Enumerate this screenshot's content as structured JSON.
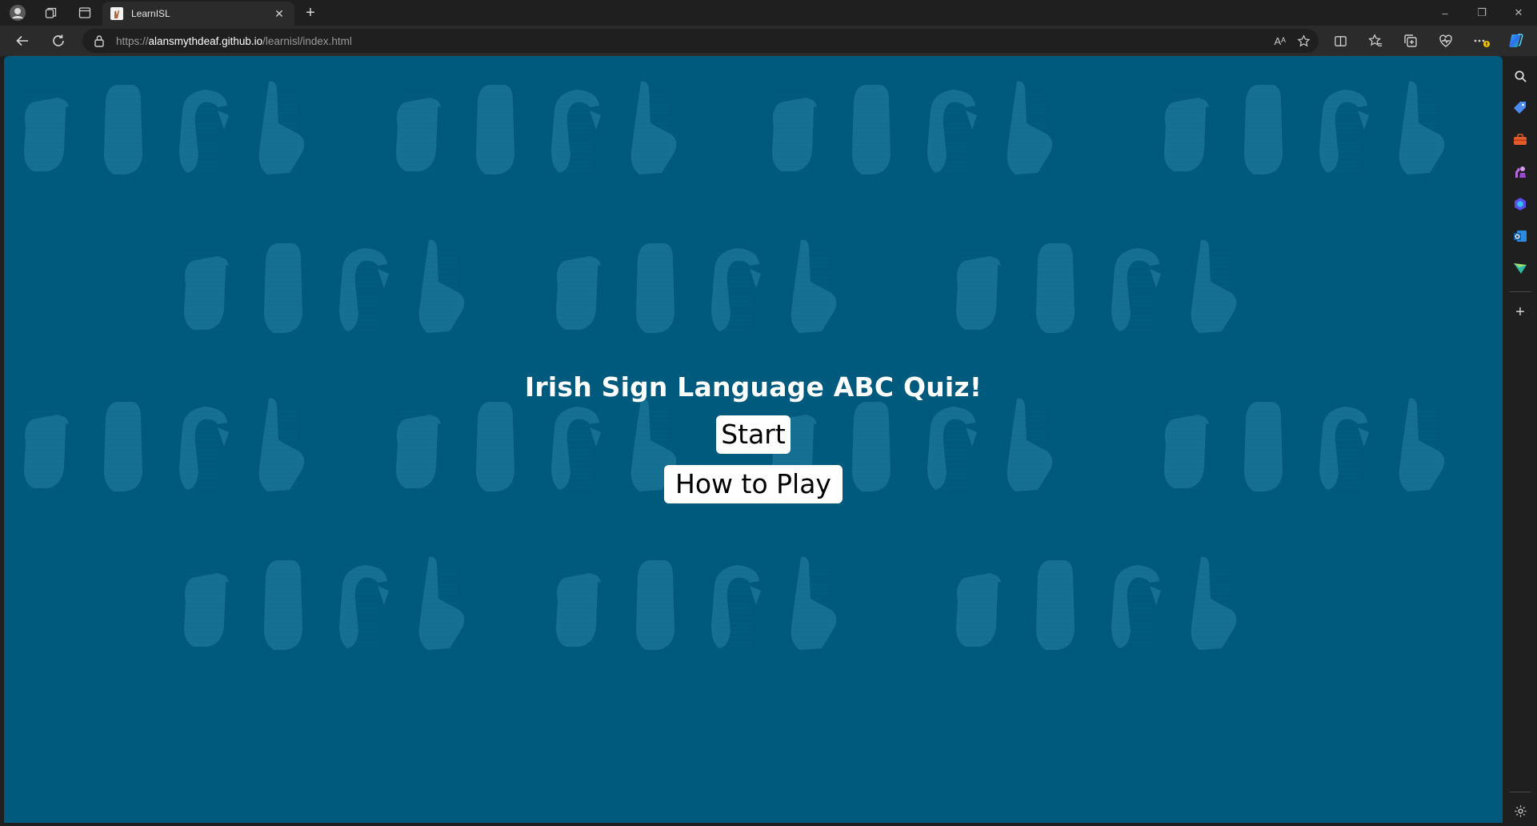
{
  "browser": {
    "tab": {
      "title": "LearnISL"
    },
    "address_bar": {
      "scheme": "https://",
      "host": "alansmythdeaf.github.io",
      "path": "/learnisl/index.html",
      "read_aloud_label": "Aᴬ"
    },
    "window_controls": {
      "minimize": "–",
      "restore": "❐",
      "close": "✕"
    },
    "new_tab": "+",
    "tab_close": "✕"
  },
  "page": {
    "title": "Irish Sign Language ABC Quiz!",
    "start_button": "Start",
    "how_to_play_button": "How to Play",
    "background_color": "#005a7d",
    "pattern_color": "#1a7497"
  },
  "sidebar": {
    "icons": [
      "search-icon",
      "shopping-tag-icon",
      "tools-icon",
      "games-icon",
      "copilot-icon",
      "outlook-icon",
      "send-icon"
    ],
    "add_label": "+"
  }
}
